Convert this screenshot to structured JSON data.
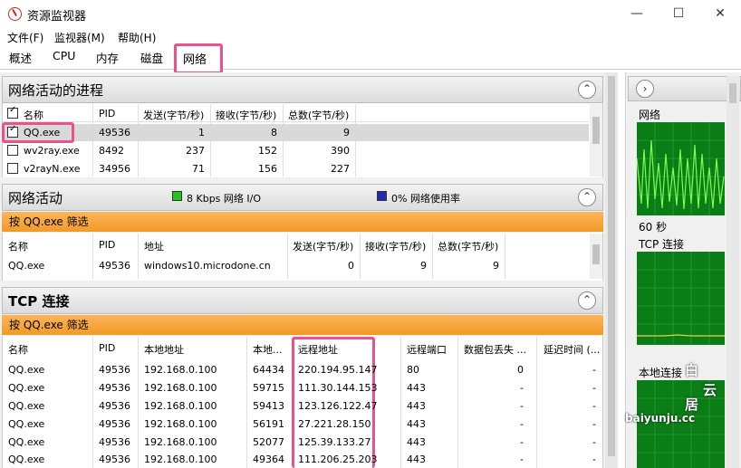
{
  "window": {
    "title": "资源监视器",
    "minimize": "—",
    "maximize": "☐",
    "close": "✕"
  },
  "menu": [
    "文件(F)",
    "监视器(M)",
    "帮助(H)"
  ],
  "tabs": [
    "概述",
    "CPU",
    "内存",
    "磁盘",
    "网络"
  ],
  "active_tab": "网络",
  "processes_section": {
    "title": "网络活动的进程",
    "columns": [
      "名称",
      "PID",
      "发送(字节/秒)",
      "接收(字节/秒)",
      "总数(字节/秒)"
    ],
    "rows": [
      {
        "name": "QQ.exe",
        "pid": "49536",
        "send": "1",
        "recv": "8",
        "total": "9",
        "checked": true
      },
      {
        "name": "wv2ray.exe",
        "pid": "8492",
        "send": "237",
        "recv": "152",
        "total": "390",
        "checked": false
      },
      {
        "name": "v2rayN.exe",
        "pid": "34956",
        "send": "71",
        "recv": "156",
        "total": "227",
        "checked": false
      }
    ]
  },
  "network_activity": {
    "title": "网络活动",
    "io_label": "8 Kbps 网络 I/O",
    "usage_label": "0% 网络使用率",
    "filter": "按 QQ.exe 筛选",
    "columns": [
      "名称",
      "PID",
      "地址",
      "发送(字节/秒)",
      "接收(字节/秒)",
      "总数(字节/秒)"
    ],
    "rows": [
      {
        "name": "QQ.exe",
        "pid": "49536",
        "addr": "windows10.microdone.cn",
        "send": "0",
        "recv": "9",
        "total": "9"
      }
    ]
  },
  "tcp": {
    "title": "TCP 连接",
    "filter": "按 QQ.exe 筛选",
    "columns": [
      "名称",
      "PID",
      "本地地址",
      "本地...",
      "远程地址",
      "远程端口",
      "数据包丢失 ...",
      "延迟时间 (..."
    ],
    "rows": [
      {
        "name": "QQ.exe",
        "pid": "49536",
        "local": "192.168.0.100",
        "lport": "64434",
        "remote": "220.194.95.147",
        "rport": "80",
        "loss": "0",
        "lat": "-"
      },
      {
        "name": "QQ.exe",
        "pid": "49536",
        "local": "192.168.0.100",
        "lport": "59715",
        "remote": "111.30.144.153",
        "rport": "443",
        "loss": "-",
        "lat": "-"
      },
      {
        "name": "QQ.exe",
        "pid": "49536",
        "local": "192.168.0.100",
        "lport": "59413",
        "remote": "123.126.122.47",
        "rport": "443",
        "loss": "-",
        "lat": "-"
      },
      {
        "name": "QQ.exe",
        "pid": "49536",
        "local": "192.168.0.100",
        "lport": "56191",
        "remote": "27.221.28.150",
        "rport": "443",
        "loss": "-",
        "lat": "-"
      },
      {
        "name": "QQ.exe",
        "pid": "49536",
        "local": "192.168.0.100",
        "lport": "52077",
        "remote": "125.39.133.27",
        "rport": "443",
        "loss": "-",
        "lat": "-"
      },
      {
        "name": "QQ.exe",
        "pid": "49536",
        "local": "192.168.0.100",
        "lport": "49364",
        "remote": "111.206.25.203",
        "rport": "443",
        "loss": "-",
        "lat": "-"
      }
    ]
  },
  "right_panel": {
    "network_label": "网络",
    "time_label": "60 秒",
    "tcp_label": "TCP 连接",
    "local_label": "本地连接"
  },
  "watermark": {
    "line1": "白",
    "line2": "云",
    "line3": "居",
    "url": "baiyunju.cc"
  },
  "colors": {
    "accent_pink": "#e9528a",
    "graph_green": "#0a7d17",
    "line_green": "#7cff4c",
    "filter_orange": "#f39a25"
  }
}
